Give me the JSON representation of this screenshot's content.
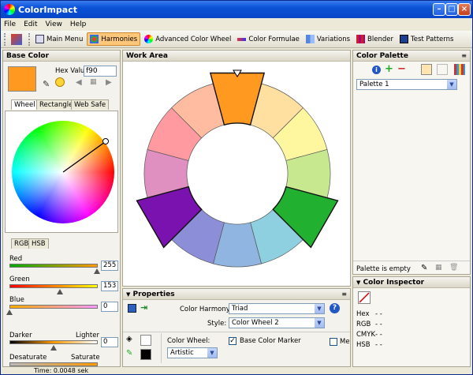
{
  "window": {
    "title": "ColorImpact"
  },
  "menu": [
    "File",
    "Edit",
    "View",
    "Help"
  ],
  "toolbar": {
    "items": [
      {
        "label": "Main Menu",
        "active": false
      },
      {
        "label": "Harmonies",
        "active": true
      },
      {
        "label": "Advanced Color Wheel",
        "active": false
      },
      {
        "label": "Color Formulae",
        "active": false
      },
      {
        "label": "Variations",
        "active": false
      },
      {
        "label": "Blender",
        "active": false
      },
      {
        "label": "Test Patterns",
        "active": false
      }
    ]
  },
  "base_color": {
    "title": "Base Color",
    "hex_label": "Hex Value:",
    "hex_value": "f90",
    "swatch_color": "#ff9920",
    "tabs": [
      "Wheel",
      "Rectangle",
      "Web Safe"
    ],
    "model_tabs": [
      "RGB",
      "HSB"
    ],
    "red_label": "Red",
    "red_value": "255",
    "green_label": "Green",
    "green_value": "153",
    "blue_label": "Blue",
    "blue_value": "0",
    "darker_label": "Darker",
    "lighter_label": "Lighter",
    "dl_value": "0",
    "desaturate_label": "Desaturate",
    "saturate_label": "Saturate"
  },
  "work_area": {
    "title": "Work Area"
  },
  "wheel": {
    "segments": [
      {
        "color": "#ff9920",
        "selected": true
      },
      {
        "color": "#ffe0a0",
        "selected": false
      },
      {
        "color": "#fff7a0",
        "selected": false
      },
      {
        "color": "#c8e890",
        "selected": false
      },
      {
        "color": "#22b030",
        "selected": true
      },
      {
        "color": "#8ed0e0",
        "selected": false
      },
      {
        "color": "#8fb5e0",
        "selected": false
      },
      {
        "color": "#8c8fd8",
        "selected": false
      },
      {
        "color": "#7a12b0",
        "selected": true
      },
      {
        "color": "#e090c0",
        "selected": false
      },
      {
        "color": "#ff9aa0",
        "selected": false
      },
      {
        "color": "#ffbca0",
        "selected": false
      }
    ]
  },
  "palette": {
    "title": "Color Palette",
    "selected": "Palette 1",
    "empty_text": "Palette is empty"
  },
  "properties": {
    "title": "Properties",
    "harmony_label": "Color Harmony:",
    "harmony_value": "Triad",
    "style_label": "Style:",
    "style_value": "Color Wheel 2",
    "color_wheel_label": "Color Wheel:",
    "color_wheel_value": "Artistic",
    "base_marker_label": "Base Color Marker",
    "base_marker_checked": true,
    "me_label": "Me"
  },
  "inspector": {
    "title": "Color Inspector",
    "hex_label": "Hex",
    "hex_value": "- -",
    "rgb_label": "RGB",
    "rgb_value": "- -",
    "cmyk_label": "CMYK",
    "cmyk_value": "- -",
    "hsb_label": "HSB",
    "hsb_value": "- -"
  },
  "status": {
    "time": "Time: 0.0048 sek"
  }
}
